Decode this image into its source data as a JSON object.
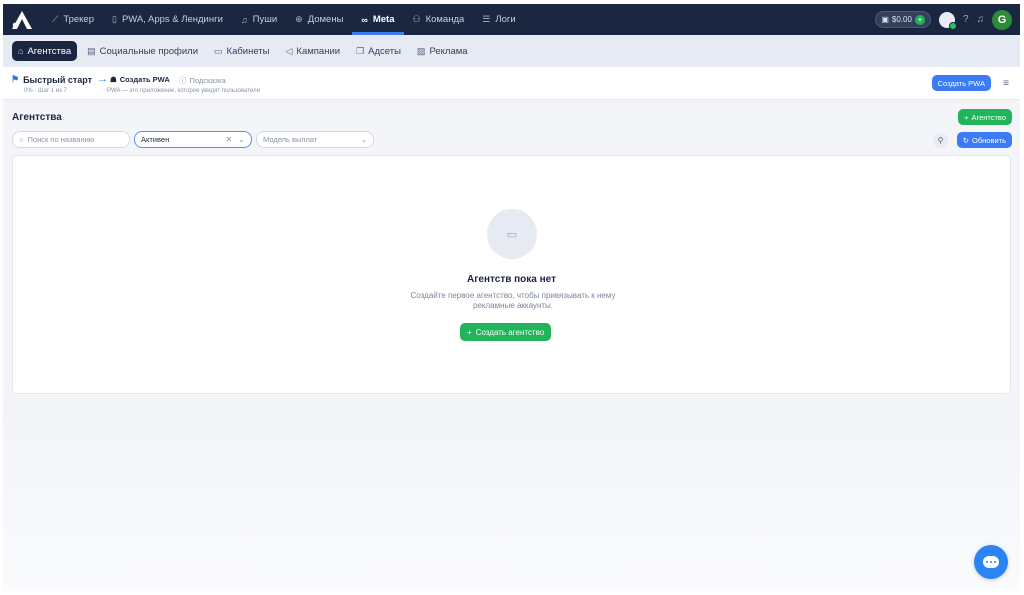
{
  "topnav": {
    "items": [
      {
        "label": "Трекер",
        "icon": "chart-line-icon"
      },
      {
        "label": "PWA, Apps & Лендинги",
        "icon": "phone-icon"
      },
      {
        "label": "Пуши",
        "icon": "bell-icon"
      },
      {
        "label": "Домены",
        "icon": "globe-icon"
      },
      {
        "label": "Meta",
        "icon": "infinity-icon",
        "active": true
      },
      {
        "label": "Команда",
        "icon": "users-icon"
      },
      {
        "label": "Логи",
        "icon": "list-icon"
      }
    ],
    "balance": "$0.00",
    "avatar_letter": "G"
  },
  "subnav": {
    "items": [
      {
        "label": "Агентства",
        "icon": "bank-icon",
        "active": true
      },
      {
        "label": "Социальные профили",
        "icon": "id-card-icon"
      },
      {
        "label": "Кабинеты",
        "icon": "briefcase-icon"
      },
      {
        "label": "Кампании",
        "icon": "megaphone-icon"
      },
      {
        "label": "Адсеты",
        "icon": "layers-icon"
      },
      {
        "label": "Реклама",
        "icon": "image-icon"
      }
    ]
  },
  "quickstart": {
    "title": "Быстрый старт",
    "progress": "0% · Шаг 1 из 7",
    "step": "Создать PWA",
    "hint": "Подсказка",
    "description": "PWA — это приложение, которое увидят пользователи",
    "create_pwa_label": "Создать PWA"
  },
  "page": {
    "title": "Агентства",
    "add_label": "Агентство",
    "refresh_label": "Обновить"
  },
  "filters": {
    "search_placeholder": "Поиск по названию",
    "status_value": "Активен",
    "model_placeholder": "Модель выплат"
  },
  "empty": {
    "title": "Агентств пока нет",
    "description": "Создайте первое агентство, чтобы привязывать к нему рекламные аккаунты.",
    "button_label": "Создать агентство"
  },
  "colors": {
    "nav_bg": "#1b2640",
    "accent_blue": "#3b7cf6",
    "accent_green": "#22b45a"
  }
}
